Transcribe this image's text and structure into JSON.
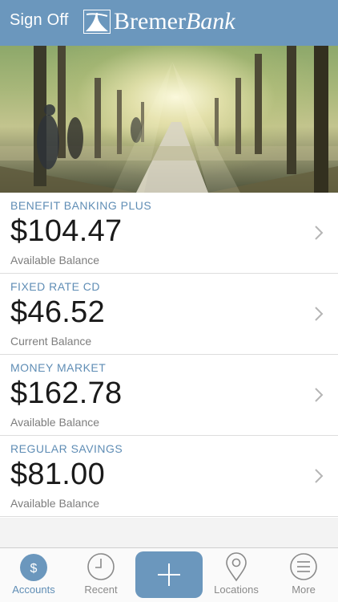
{
  "header": {
    "sign_off": "Sign Off",
    "logo_text_main": "Bremer",
    "logo_text_bank": "Bank",
    "color": "#6b97bd"
  },
  "hero": {
    "icon": "tree-lined-path-photo"
  },
  "accounts": [
    {
      "name": "BENEFIT BANKING PLUS",
      "amount": "$104.47",
      "label": "Available Balance"
    },
    {
      "name": "FIXED RATE CD",
      "amount": "$46.52",
      "label": "Current Balance"
    },
    {
      "name": "MONEY MARKET",
      "amount": "$162.78",
      "label": "Available Balance"
    },
    {
      "name": "REGULAR SAVINGS",
      "amount": "$81.00",
      "label": "Available Balance"
    }
  ],
  "tabs": {
    "accounts": {
      "label": "Accounts",
      "icon": "dollar-circle-icon",
      "active": true
    },
    "recent": {
      "label": "Recent",
      "icon": "clock-icon"
    },
    "add": {
      "icon": "plus-icon"
    },
    "locations": {
      "label": "Locations",
      "icon": "map-pin-icon"
    },
    "more": {
      "label": "More",
      "icon": "menu-icon"
    }
  },
  "colors": {
    "accent": "#6b97bd",
    "account_name": "#5f8db5",
    "text": "#1a1a1a",
    "muted": "#7d7d7d"
  }
}
